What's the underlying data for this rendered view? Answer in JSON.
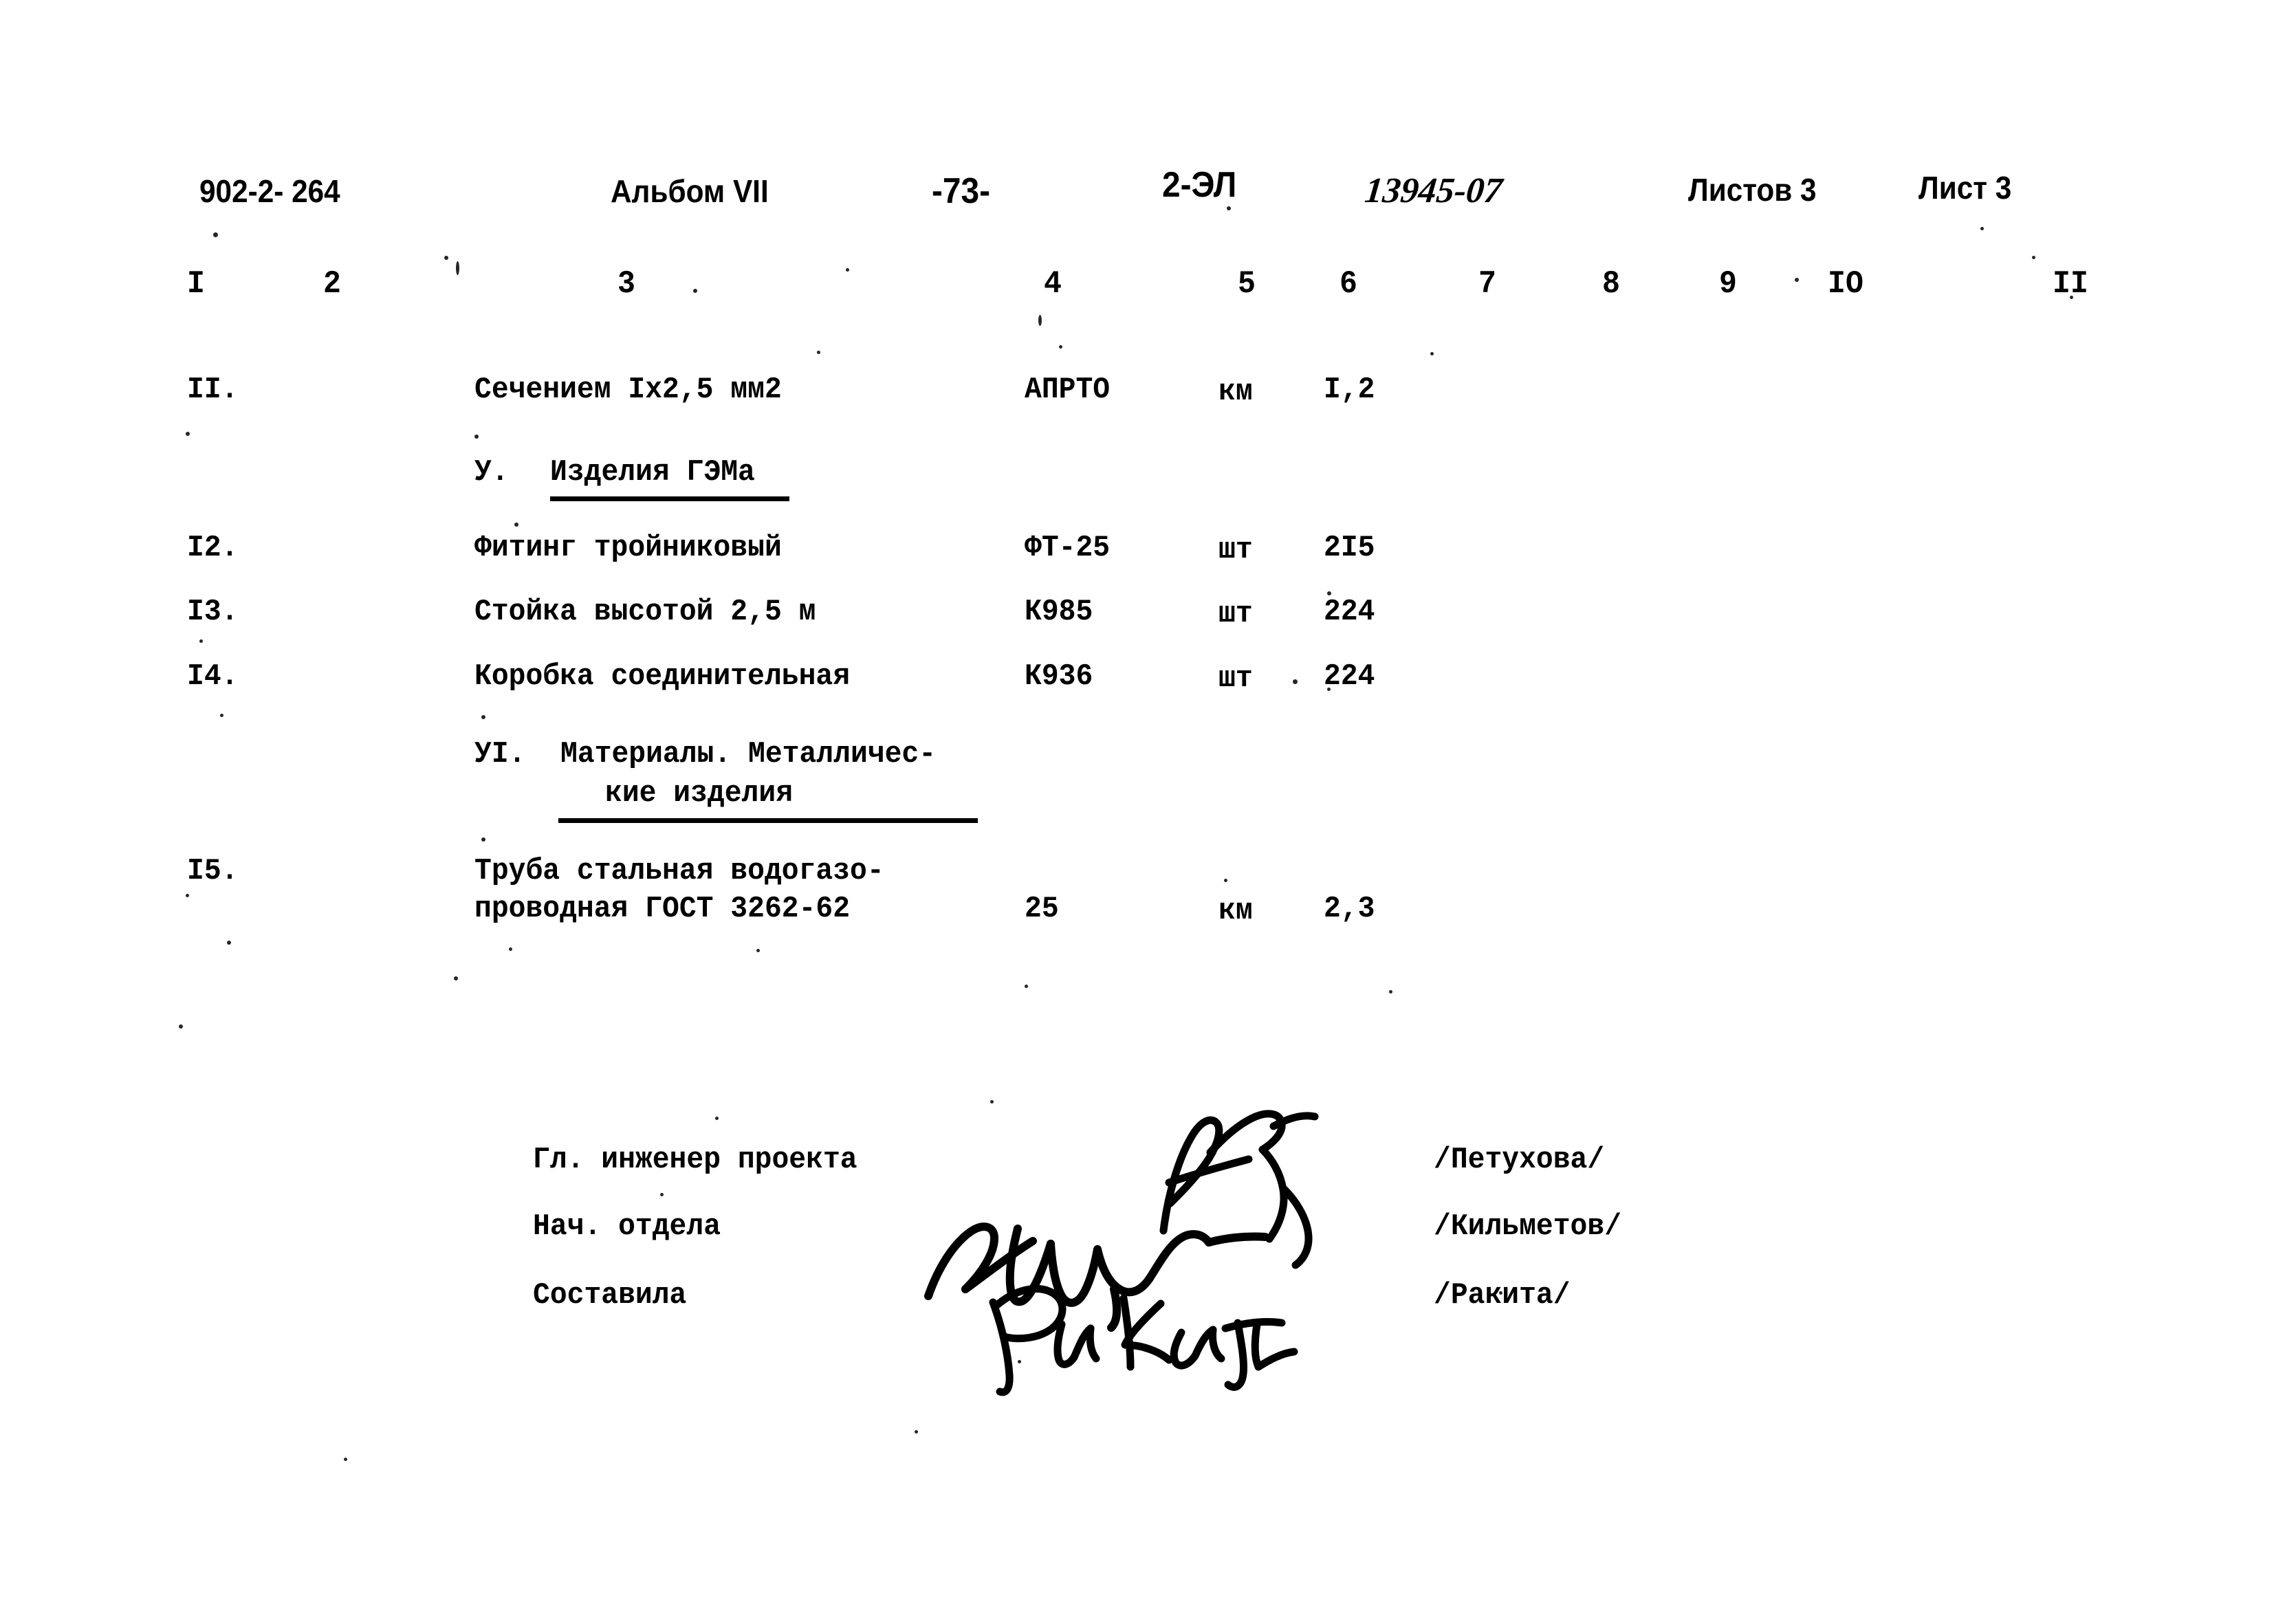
{
  "document": {
    "series_code": "902-2- 264",
    "album": "Альбом VII",
    "page_number": "-73-",
    "stamp_code": "2-ЭЛ",
    "handwritten_code": "13945-07",
    "sheets_total_label": "Листов 3",
    "sheet_label": "Лист 3"
  },
  "table": {
    "column_numbers": [
      "I",
      "2",
      "3",
      "4",
      "5",
      "6",
      "7",
      "8",
      "9",
      "IO",
      "II"
    ],
    "rows": [
      {
        "no": "II.",
        "name": "Сечением Iх2,5 мм2",
        "name2": "",
        "type": "АПРТО",
        "unit": "км",
        "qty": "I,2"
      },
      {
        "no": "I2.",
        "name": "Фитинг тройниковый",
        "name2": "",
        "type": "ФТ-25",
        "unit": "шт",
        "qty": "2I5"
      },
      {
        "no": "I3.",
        "name": "Стойка высотой 2,5 м",
        "name2": "",
        "type": "К985",
        "unit": "шт",
        "qty": "224"
      },
      {
        "no": "I4.",
        "name": "Коробка соединительная",
        "name2": "",
        "type": "К936",
        "unit": "шт",
        "qty": "224"
      },
      {
        "no": "I5.",
        "name": "Труба стальная водогазо-",
        "name2": "проводная ГОСТ 3262-62",
        "type": "25",
        "unit": "км",
        "qty": "2,3"
      }
    ],
    "sections": [
      {
        "numeral": "У.",
        "title_line1": "Изделия ГЭМа",
        "title_line2": ""
      },
      {
        "numeral": "УI.",
        "title_line1": "Материалы. Металличес-",
        "title_line2": "кие изделия"
      }
    ]
  },
  "signatures": {
    "rows": [
      {
        "role": "Гл. инженер проекта",
        "name": "/Петухова/"
      },
      {
        "role": "Нач. отдела",
        "name": "/Кильметов/"
      },
      {
        "role": "Составила",
        "name": "/Ракита/"
      }
    ]
  },
  "colors": {
    "ink": "#000000",
    "paper": "#ffffff"
  }
}
